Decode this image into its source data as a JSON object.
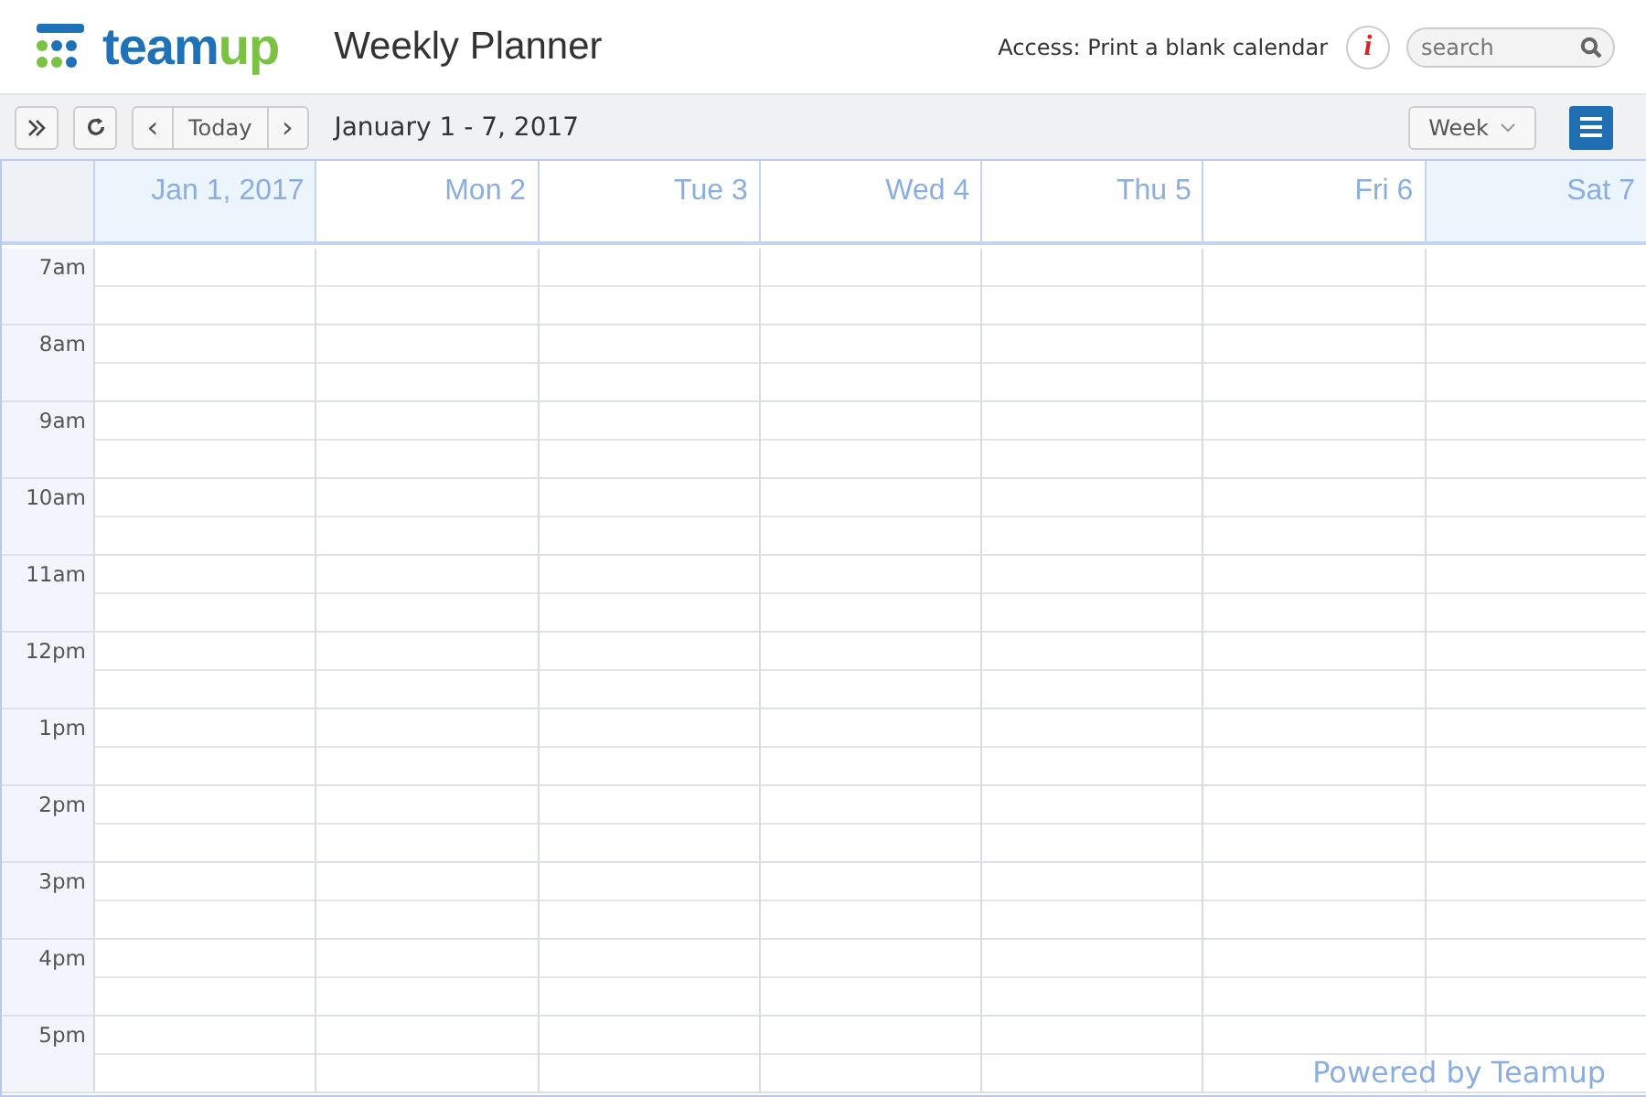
{
  "header": {
    "logo_parts": [
      "team",
      "up"
    ],
    "title": "Weekly Planner",
    "access": "Access: Print a blank calendar",
    "info": "i",
    "search": {
      "placeholder": "search"
    }
  },
  "toolbar": {
    "today": "Today",
    "prev": "‹",
    "next": "›",
    "range": "January 1 - 7, 2017",
    "view": "Week"
  },
  "days": [
    {
      "label": "Jan 1, 2017",
      "weekend": true
    },
    {
      "label": "Mon 2",
      "weekend": false
    },
    {
      "label": "Tue 3",
      "weekend": false
    },
    {
      "label": "Wed 4",
      "weekend": false
    },
    {
      "label": "Thu 5",
      "weekend": false
    },
    {
      "label": "Fri 6",
      "weekend": false
    },
    {
      "label": "Sat 7",
      "weekend": true
    }
  ],
  "hours": [
    "7am",
    "8am",
    "9am",
    "10am",
    "11am",
    "12pm",
    "1pm",
    "2pm",
    "3pm",
    "4pm",
    "5pm"
  ],
  "footer": "Powered by Teamup"
}
